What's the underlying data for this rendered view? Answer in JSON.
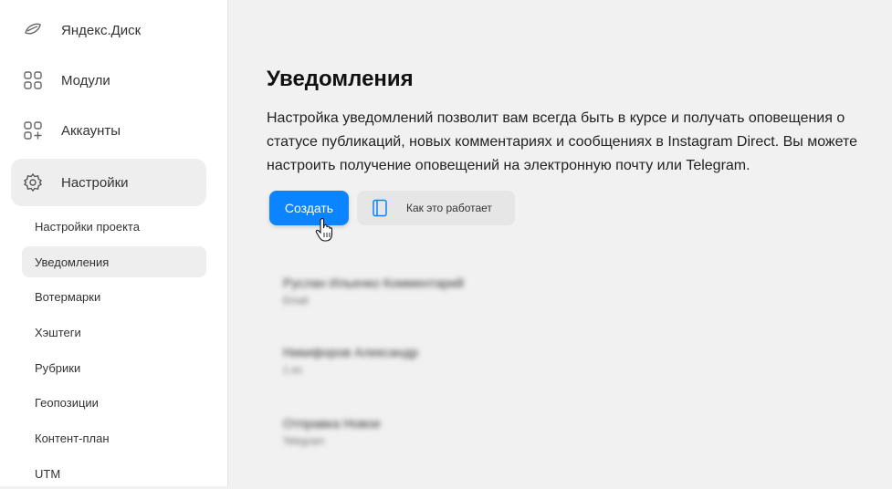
{
  "sidebar": {
    "nav": [
      {
        "label": "Яндекс.Диск",
        "icon": "cloud-disk-icon"
      },
      {
        "label": "Модули",
        "icon": "modules-icon"
      },
      {
        "label": "Аккаунты",
        "icon": "add-account-icon"
      },
      {
        "label": "Настройки",
        "icon": "gear-icon"
      }
    ],
    "sub_items": [
      {
        "label": "Настройки проекта"
      },
      {
        "label": "Уведомления"
      },
      {
        "label": "Вотермарки"
      },
      {
        "label": "Хэштеги"
      },
      {
        "label": "Рубрики"
      },
      {
        "label": "Геопозиции"
      },
      {
        "label": "Контент-план"
      },
      {
        "label": "UTM"
      }
    ]
  },
  "main": {
    "title": "Уведомления",
    "description": "Настройка уведомлений позволит вам всегда быть в курсе и получать оповещения о статусе публикаций, новых комментариях и сообщениях в Instagram Direct. Вы можете настроить получение оповещений на электронную почту или Telegram.",
    "create_label": "Создать",
    "how_it_works_label": "Как это работает",
    "how_it_works_icon": "book-icon",
    "blurred_items": [
      {
        "title": "Руслан Ильенко Комментарий",
        "sub": "Email"
      },
      {
        "title": "Никифоров Александр",
        "sub": "1 из"
      },
      {
        "title": "Отправка Новое",
        "sub": "Telegram"
      }
    ]
  },
  "colors": {
    "accent": "#0a84ff",
    "sidebar_bg": "#ffffff",
    "main_bg": "#f1f1f1",
    "active_bg": "#eeeeee"
  }
}
